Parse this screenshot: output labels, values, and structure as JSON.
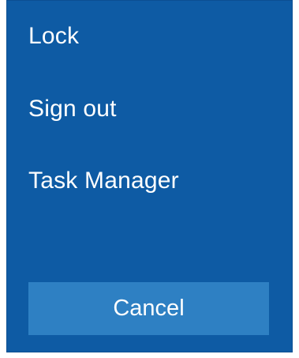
{
  "menu": {
    "items": [
      {
        "label": "Lock"
      },
      {
        "label": "Sign out"
      },
      {
        "label": "Task Manager"
      }
    ]
  },
  "cancel": {
    "label": "Cancel"
  },
  "colors": {
    "background": "#0e5ba4",
    "button": "#2e80c3",
    "text": "#ffffff"
  }
}
